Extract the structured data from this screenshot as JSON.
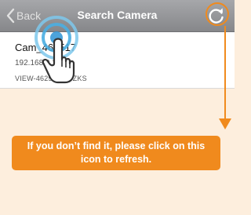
{
  "navbar": {
    "back_label": "Back",
    "title": "Search Camera",
    "refresh_icon": "refresh-icon"
  },
  "camera_list": [
    {
      "name": "Cam_462517",
      "ip": "192.168.0.104",
      "uid": "VIEW-462517-KSZKS"
    }
  ],
  "hint": {
    "icon": "tap-hand-icon",
    "callout_text": "If you don’t find it, please click on this icon to refresh."
  },
  "colors": {
    "accent": "#f08a1d",
    "background": "#fdeedd",
    "navbar": "#96979a"
  }
}
